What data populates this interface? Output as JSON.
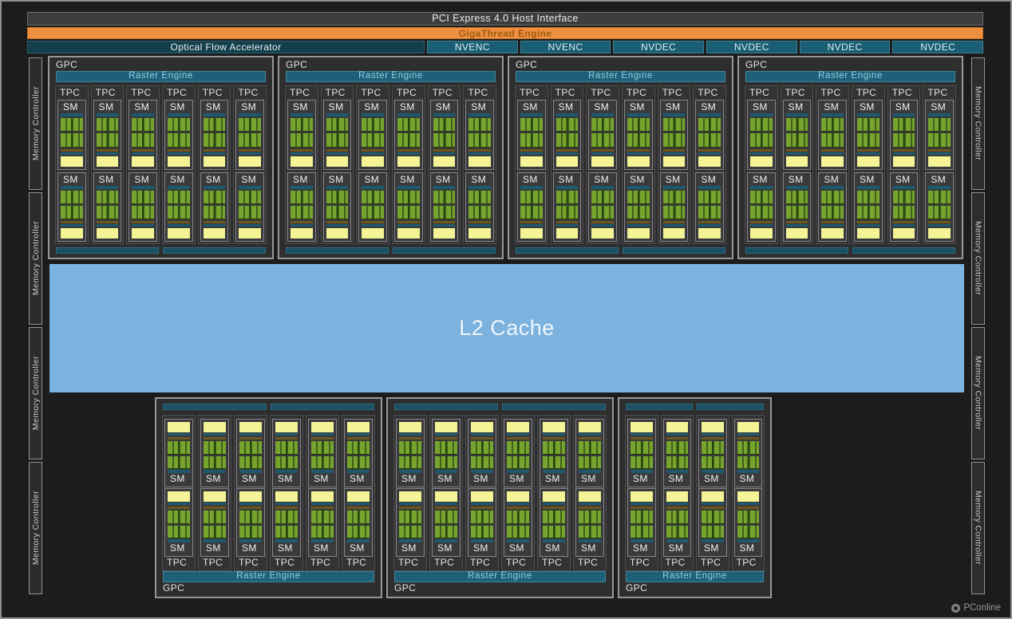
{
  "top_bars": {
    "host_interface": "PCI Express 4.0 Host Interface",
    "gigathread": "GigaThread Engine",
    "optical_flow": "Optical Flow Accelerator",
    "codec_units": [
      "NVENC",
      "NVENC",
      "NVDEC",
      "NVDEC",
      "NVDEC",
      "NVDEC"
    ]
  },
  "labels": {
    "gpc": "GPC",
    "tpc": "TPC",
    "sm": "SM",
    "raster_engine": "Raster Engine",
    "memory_controller": "Memory Controller",
    "l2_cache": "L2 Cache"
  },
  "structure": {
    "top_gpcs": [
      {
        "tpcs": 6
      },
      {
        "tpcs": 6
      },
      {
        "tpcs": 6
      },
      {
        "tpcs": 6
      }
    ],
    "bottom_gpcs": [
      {
        "tpcs": 6
      },
      {
        "tpcs": 6
      },
      {
        "tpcs": 4
      }
    ],
    "sms_per_tpc": 2,
    "green_blocks_per_sm": 2,
    "memory_controllers_per_side": 4,
    "wide_bars_per_gpc": 2
  },
  "watermark": {
    "text": "PConline",
    "icon": "pconline-logo"
  },
  "colors": {
    "background": "#1c1c1d",
    "host_bar": "#3d3d3f",
    "gigathread_orange": "#ee9040",
    "optical_flow_teal": "#133f4c",
    "codec_teal": "#1a5e73",
    "raster_teal": "#1d6078",
    "raster_text": "#8fd2e2",
    "green_stripe": "#76a42e",
    "green_dark": "#41601a",
    "yellow_block": "#f4f496",
    "olive_strip": "#6d571d",
    "teal_strip": "#1d5a6e",
    "l2_blue": "#7bb2de",
    "gpc_background": "#2e2e2f",
    "border_gray": "#97979a"
  }
}
